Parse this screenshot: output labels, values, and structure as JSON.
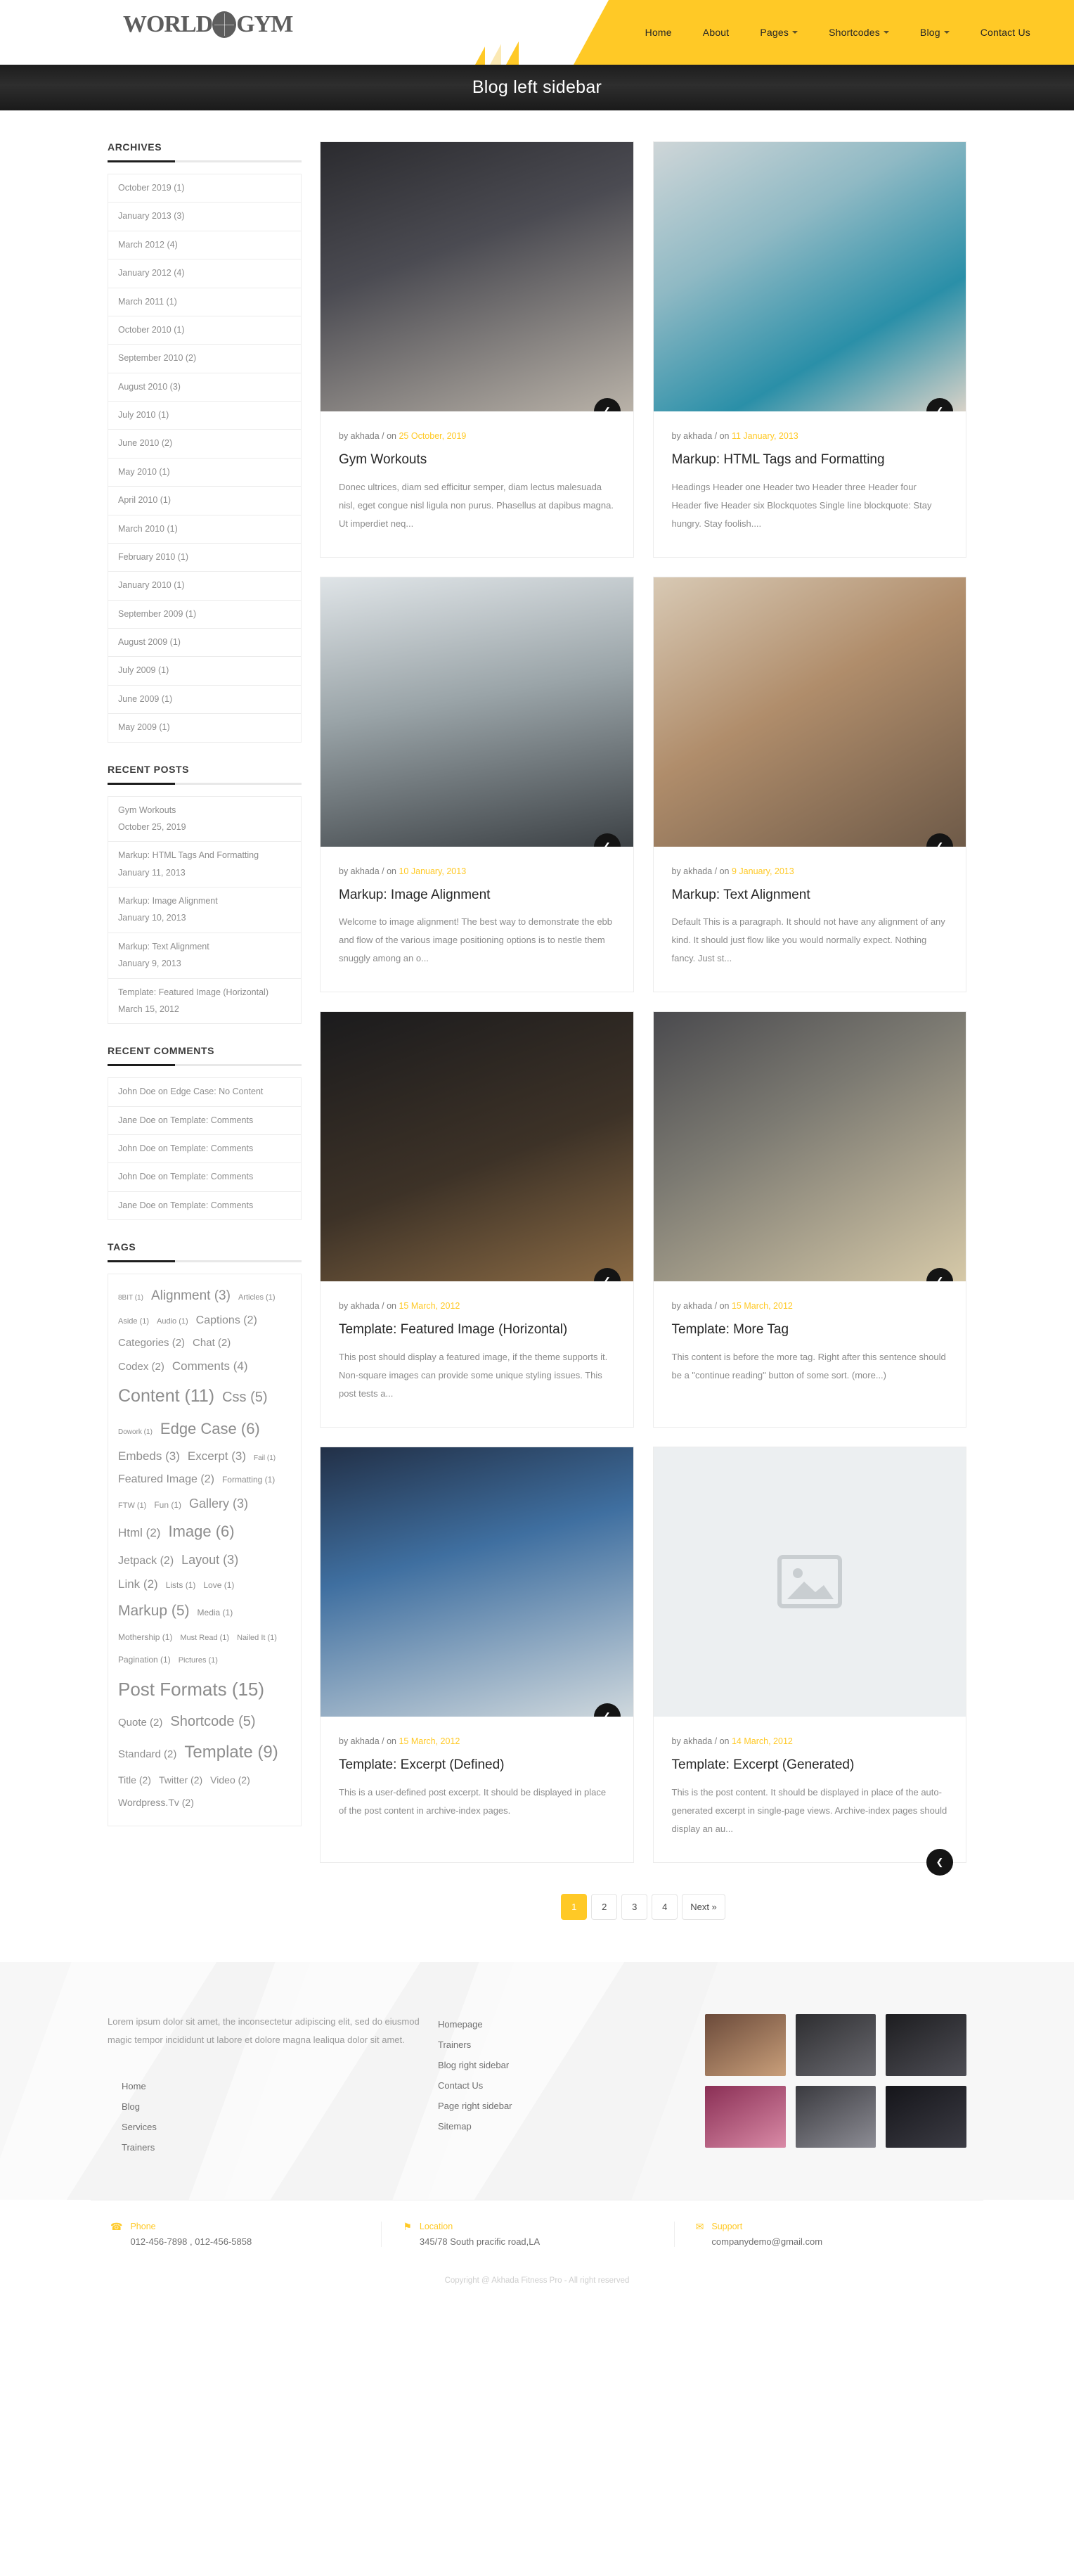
{
  "brand": {
    "logo_text_left": "WORLD",
    "logo_text_right": "GYM",
    "accent": "#ffc926"
  },
  "nav": {
    "items": [
      {
        "label": "Home",
        "has_dropdown": false
      },
      {
        "label": "About",
        "has_dropdown": false
      },
      {
        "label": "Pages",
        "has_dropdown": true
      },
      {
        "label": "Shortcodes",
        "has_dropdown": true
      },
      {
        "label": "Blog",
        "has_dropdown": true
      },
      {
        "label": "Contact Us",
        "has_dropdown": false
      }
    ]
  },
  "banner": {
    "title": "Blog left sidebar"
  },
  "sidebar": {
    "archives": {
      "title": "ARCHIVES",
      "items": [
        "October 2019 (1)",
        "January 2013 (3)",
        "March 2012 (4)",
        "January 2012 (4)",
        "March 2011 (1)",
        "October 2010 (1)",
        "September 2010 (2)",
        "August 2010 (3)",
        "July 2010 (1)",
        "June 2010 (2)",
        "May 2010 (1)",
        "April 2010 (1)",
        "March 2010 (1)",
        "February 2010 (1)",
        "January 2010 (1)",
        "September 2009 (1)",
        "August 2009 (1)",
        "July 2009 (1)",
        "June 2009 (1)",
        "May 2009 (1)"
      ]
    },
    "recent_posts": {
      "title": "RECENT POSTS",
      "items": [
        {
          "title": "Gym Workouts",
          "date": "October 25, 2019"
        },
        {
          "title": "Markup: HTML Tags And Formatting",
          "date": "January 11, 2013"
        },
        {
          "title": "Markup: Image Alignment",
          "date": "January 10, 2013"
        },
        {
          "title": "Markup: Text Alignment",
          "date": "January 9, 2013"
        },
        {
          "title": "Template: Featured Image (Horizontal)",
          "date": "March 15, 2012"
        }
      ]
    },
    "recent_comments": {
      "title": "RECENT COMMENTS",
      "items": [
        "John Doe on Edge Case: No Content",
        "Jane Doe on Template: Comments",
        "John Doe on Template: Comments",
        "John Doe on Template: Comments",
        "Jane Doe on Template: Comments"
      ]
    },
    "tags": {
      "title": "TAGS",
      "items": [
        {
          "label": "8BIT (1)",
          "size": 10
        },
        {
          "label": "Alignment (3)",
          "size": 19
        },
        {
          "label": "Articles (1)",
          "size": 11
        },
        {
          "label": "Aside (1)",
          "size": 11
        },
        {
          "label": "Audio (1)",
          "size": 11
        },
        {
          "label": "Captions (2)",
          "size": 16
        },
        {
          "label": "Categories (2)",
          "size": 15
        },
        {
          "label": "Chat (2)",
          "size": 15
        },
        {
          "label": "Codex (2)",
          "size": 15
        },
        {
          "label": "Comments (4)",
          "size": 17
        },
        {
          "label": "Content (11)",
          "size": 25
        },
        {
          "label": "Css (5)",
          "size": 20
        },
        {
          "label": "Dowork (1)",
          "size": 10
        },
        {
          "label": "Edge Case (6)",
          "size": 22
        },
        {
          "label": "Embeds (3)",
          "size": 17
        },
        {
          "label": "Excerpt (3)",
          "size": 17
        },
        {
          "label": "Fail (1)",
          "size": 10
        },
        {
          "label": "Featured Image (2)",
          "size": 16
        },
        {
          "label": "Formatting (1)",
          "size": 12
        },
        {
          "label": "FTW (1)",
          "size": 11
        },
        {
          "label": "Fun (1)",
          "size": 12
        },
        {
          "label": "Gallery (3)",
          "size": 18
        },
        {
          "label": "Html (2)",
          "size": 17
        },
        {
          "label": "Image (6)",
          "size": 22
        },
        {
          "label": "Jetpack (2)",
          "size": 16
        },
        {
          "label": "Layout (3)",
          "size": 18
        },
        {
          "label": "Link (2)",
          "size": 17
        },
        {
          "label": "Lists (1)",
          "size": 12
        },
        {
          "label": "Love (1)",
          "size": 12
        },
        {
          "label": "Markup (5)",
          "size": 21
        },
        {
          "label": "Media (1)",
          "size": 12
        },
        {
          "label": "Mothership (1)",
          "size": 12
        },
        {
          "label": "Must Read (1)",
          "size": 11
        },
        {
          "label": "Nailed It (1)",
          "size": 11
        },
        {
          "label": "Pagination (1)",
          "size": 12
        },
        {
          "label": "Pictures (1)",
          "size": 11
        },
        {
          "label": "Post Formats (15)",
          "size": 26
        },
        {
          "label": "Quote (2)",
          "size": 15
        },
        {
          "label": "Shortcode (5)",
          "size": 20
        },
        {
          "label": "Standard (2)",
          "size": 15
        },
        {
          "label": "Template (9)",
          "size": 24
        },
        {
          "label": "Title (2)",
          "size": 14
        },
        {
          "label": "Twitter (2)",
          "size": 14
        },
        {
          "label": "Video (2)",
          "size": 14
        },
        {
          "label": "Wordpress.Tv (2)",
          "size": 14
        }
      ]
    }
  },
  "posts": [
    {
      "author_prefix": "by akhada / on ",
      "date": "25 October, 2019",
      "title": "Gym Workouts",
      "excerpt": "Donec ultrices, diam sed efficitur semper, diam lectus malesuada nisl, eget congue nisl ligula non purus. Phasellus at dapibus magna. Ut imperdiet neq...",
      "image_class": "img-a",
      "share_label": "❮",
      "has_image": true
    },
    {
      "author_prefix": "by akhada / on ",
      "date": "11 January, 2013",
      "title": "Markup: HTML Tags and Formatting",
      "excerpt": "Headings Header one Header two Header three Header four Header five Header six Blockquotes Single line blockquote: Stay hungry. Stay foolish....",
      "image_class": "img-b",
      "share_label": "❮",
      "has_image": true
    },
    {
      "author_prefix": "by akhada / on ",
      "date": "10 January, 2013",
      "title": "Markup: Image Alignment",
      "excerpt": "Welcome to image alignment! The best way to demonstrate the ebb and flow of the various image positioning options is to nestle them snuggly among an o...",
      "image_class": "img-c",
      "share_label": "❮",
      "has_image": true
    },
    {
      "author_prefix": "by akhada / on ",
      "date": "9 January, 2013",
      "title": "Markup: Text Alignment",
      "excerpt": "Default This is a paragraph. It should not have any alignment of any kind. It should just flow like you would normally expect. Nothing fancy. Just st...",
      "image_class": "img-d",
      "share_label": "❮",
      "has_image": true
    },
    {
      "author_prefix": "by akhada / on ",
      "date": "15 March, 2012",
      "title": "Template: Featured Image (Horizontal)",
      "excerpt": "This post should display a featured image, if the theme supports it. Non-square images can provide some unique styling issues. This post tests a...",
      "image_class": "img-e",
      "share_label": "❮",
      "has_image": true
    },
    {
      "author_prefix": "by akhada / on ",
      "date": "15 March, 2012",
      "title": "Template: More Tag",
      "excerpt": "This content is before the more tag. Right after this sentence should be a \"continue reading\" button of some sort. (more...)",
      "image_class": "img-f",
      "share_label": "❮",
      "has_image": true
    },
    {
      "author_prefix": "by akhada / on ",
      "date": "15 March, 2012",
      "title": "Template: Excerpt (Defined)",
      "excerpt": "This is a user-defined post excerpt. It should be displayed in place of the post content in archive-index pages.",
      "image_class": "img-g",
      "share_label": "❮",
      "has_image": true
    },
    {
      "author_prefix": "by akhada / on ",
      "date": "14 March, 2012",
      "title": "Template: Excerpt (Generated)",
      "excerpt": "This is the post content. It should be displayed in place of the auto-generated excerpt in single-page views. Archive-index pages should display an au...",
      "image_class": "",
      "share_label": "❮",
      "has_image": false
    }
  ],
  "pagination": {
    "pages": [
      "1",
      "2",
      "3",
      "4"
    ],
    "next_label": "Next »",
    "active": "1"
  },
  "footer": {
    "about": "Lorem ipsum dolor sit amet, the inconsectetur adipiscing elit, sed do eiusmod magic tempor incididunt ut labore et dolore magna lealiqua dolor sit amet.",
    "links_left": [
      "Home",
      "Blog",
      "Services",
      "Trainers"
    ],
    "links_right": [
      "Homepage",
      "Trainers",
      "Blog right sidebar",
      "Contact Us",
      "Page right sidebar",
      "Sitemap"
    ],
    "gallery": [
      {
        "cls": "g1"
      },
      {
        "cls": "g2"
      },
      {
        "cls": "g3"
      },
      {
        "cls": "g4"
      },
      {
        "cls": "g5"
      },
      {
        "cls": "g6"
      }
    ],
    "contact": [
      {
        "icon": "phone-icon",
        "glyph": "☎",
        "label": "Phone",
        "value": "012-456-7898 , 012-456-5858"
      },
      {
        "icon": "location-icon",
        "glyph": "⚑",
        "label": "Location",
        "value": "345/78 South pracific road,LA"
      },
      {
        "icon": "mail-icon",
        "glyph": "✉",
        "label": "Support",
        "value": "companydemo@gmail.com"
      }
    ],
    "copyright": "Copyright @ Akhada Fitness Pro - All right reserved"
  }
}
